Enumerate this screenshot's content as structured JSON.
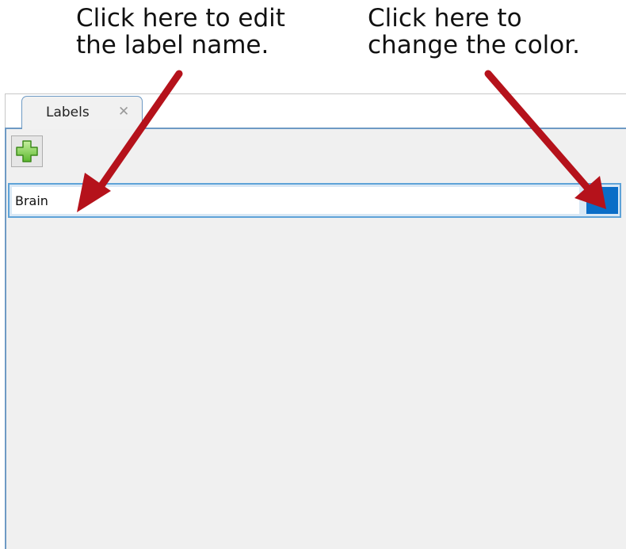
{
  "annotations": {
    "left_lines": [
      "Click here to edit",
      "the label name."
    ],
    "right_lines": [
      "Click here to",
      "change the color."
    ],
    "arrow_color": "#b5121b"
  },
  "panel": {
    "tab_label": "Labels",
    "tab_close_glyph": "✕",
    "add_button_icon": "green-plus-icon",
    "labels": [
      {
        "name": "Brain",
        "color": "#0a6dc7"
      }
    ]
  }
}
